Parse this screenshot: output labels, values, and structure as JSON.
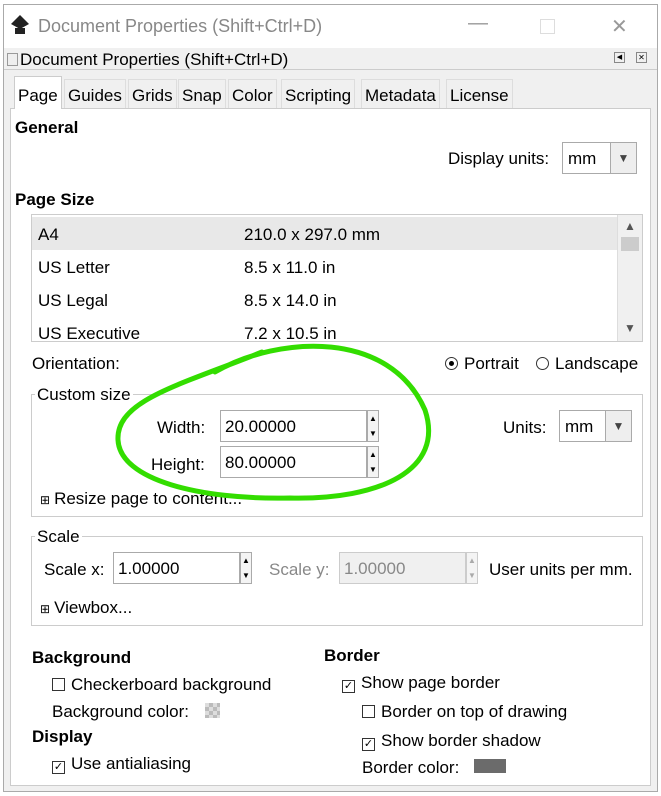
{
  "window": {
    "title": "Document Properties (Shift+Ctrl+D)",
    "minimize": "—",
    "close": "✕"
  },
  "panel": {
    "title": "Document Properties (Shift+Ctrl+D)"
  },
  "tabs": [
    {
      "label": "Page"
    },
    {
      "label": "Guides"
    },
    {
      "label": "Grids"
    },
    {
      "label": "Snap"
    },
    {
      "label": "Color"
    },
    {
      "label": "Scripting"
    },
    {
      "label": "Metadata"
    },
    {
      "label": "License"
    }
  ],
  "general": {
    "heading": "General",
    "display_units_label": "Display units:",
    "display_units_value": "mm"
  },
  "page_size": {
    "heading": "Page Size",
    "rows": [
      {
        "name": "A4",
        "size": "210.0 x 297.0 mm"
      },
      {
        "name": "US Letter",
        "size": "8.5 x 11.0 in"
      },
      {
        "name": "US Legal",
        "size": "8.5 x 14.0 in"
      },
      {
        "name": "US Executive",
        "size": "7.2 x 10.5 in"
      }
    ]
  },
  "orientation": {
    "label": "Orientation:",
    "portrait": "Portrait",
    "landscape": "Landscape",
    "selected": "Portrait"
  },
  "custom_size": {
    "legend": "Custom size",
    "width_label": "Width:",
    "width_value": "20.00000",
    "height_label": "Height:",
    "height_value": "80.00000",
    "units_label": "Units:",
    "units_value": "mm",
    "resize": "Resize page to content..."
  },
  "scale": {
    "legend": "Scale",
    "x_label": "Scale x:",
    "x_value": "1.00000",
    "y_label": "Scale y:",
    "y_value": "1.00000",
    "units_text": "User units per mm.",
    "viewbox": "Viewbox..."
  },
  "background": {
    "heading": "Background",
    "checkerboard": "Checkerboard background",
    "checkerboard_checked": false,
    "color_label": "Background color:"
  },
  "display": {
    "heading": "Display",
    "antialias": "Use antialiasing",
    "antialias_checked": true
  },
  "border": {
    "heading": "Border",
    "show_page_border": "Show page border",
    "on_top": "Border on top of drawing",
    "shadow": "Show border shadow",
    "color_label": "Border color:",
    "color": "#6b6b6b"
  },
  "annotation": {
    "color": "#33dd00"
  }
}
